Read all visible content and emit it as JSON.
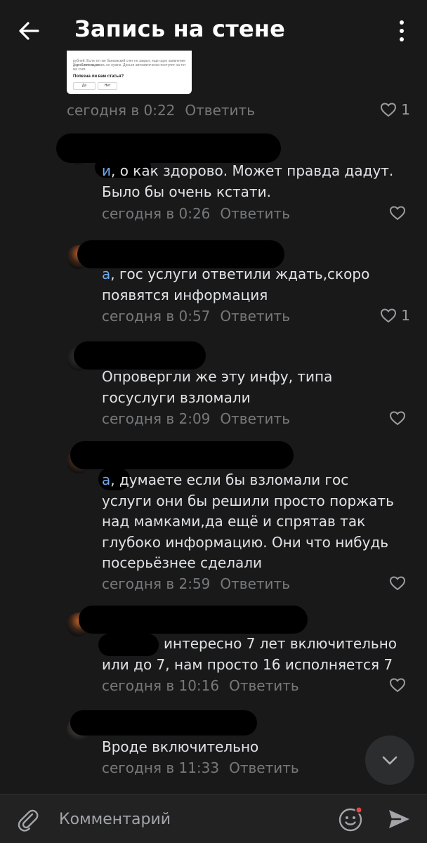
{
  "header": {
    "title": "Запись на стене",
    "back_icon": "arrow-left-icon",
    "menu_icon": "more-vertical-icon"
  },
  "preview_card": {
    "text_line1": "рублей. Если тот же банковский счет не закрыт, еще одно заявление для выплаты от",
    "text_line2": "3 до 7 лет подавать не нужно. Деньги автоматически поступят на тот же счет.",
    "question": "Полезна ли вам статья?",
    "option_yes": "Да",
    "option_no": "Нет"
  },
  "post_meta": {
    "time": "сегодня в 0:22",
    "reply_label": "Ответить",
    "likes": "1"
  },
  "comments": [
    {
      "mention": "и",
      "text": ", о как здорово. Может правда дадут. Было бы очень кстати.",
      "time": "сегодня в 0:26",
      "reply_label": "Ответить",
      "likes": ""
    },
    {
      "mention": "а",
      "text": ", гос услуги ответили ждать,скоро появятся информация",
      "time": "сегодня в 0:57",
      "reply_label": "Ответить",
      "likes": "1"
    },
    {
      "mention": "",
      "text": "Опровергли же эту инфу, типа госуслуги взломали",
      "time": "сегодня в 2:09",
      "reply_label": "Ответить",
      "likes": ""
    },
    {
      "mention": "а",
      "text": ", думаете если бы взломали гос услуги они бы решили просто поржать над мамками,да ещё и спрятав так глубоко информацию. Они что нибудь посерьёзнее сделали",
      "time": "сегодня в 2:59",
      "reply_label": "Ответить",
      "likes": ""
    },
    {
      "mention": "",
      "text": "интересно 7 лет включительно или до 7, нам просто 16 исполняется 7",
      "time": "сегодня в 10:16",
      "reply_label": "Ответить",
      "likes": ""
    },
    {
      "mention": "",
      "text": "Вроде включительно",
      "time": "сегодня в 11:33",
      "reply_label": "Ответить",
      "likes": ""
    }
  ],
  "composer": {
    "placeholder": "Комментарий",
    "attach_icon": "paperclip-icon",
    "emoji_icon": "smile-icon",
    "send_icon": "send-icon"
  },
  "colors": {
    "background": "#19191a",
    "text": "#e1e3e6",
    "secondary_text": "#76787a",
    "mention": "#71aaeb",
    "notification_dot": "#e64646"
  },
  "scroll_down_icon": "chevron-down-icon"
}
